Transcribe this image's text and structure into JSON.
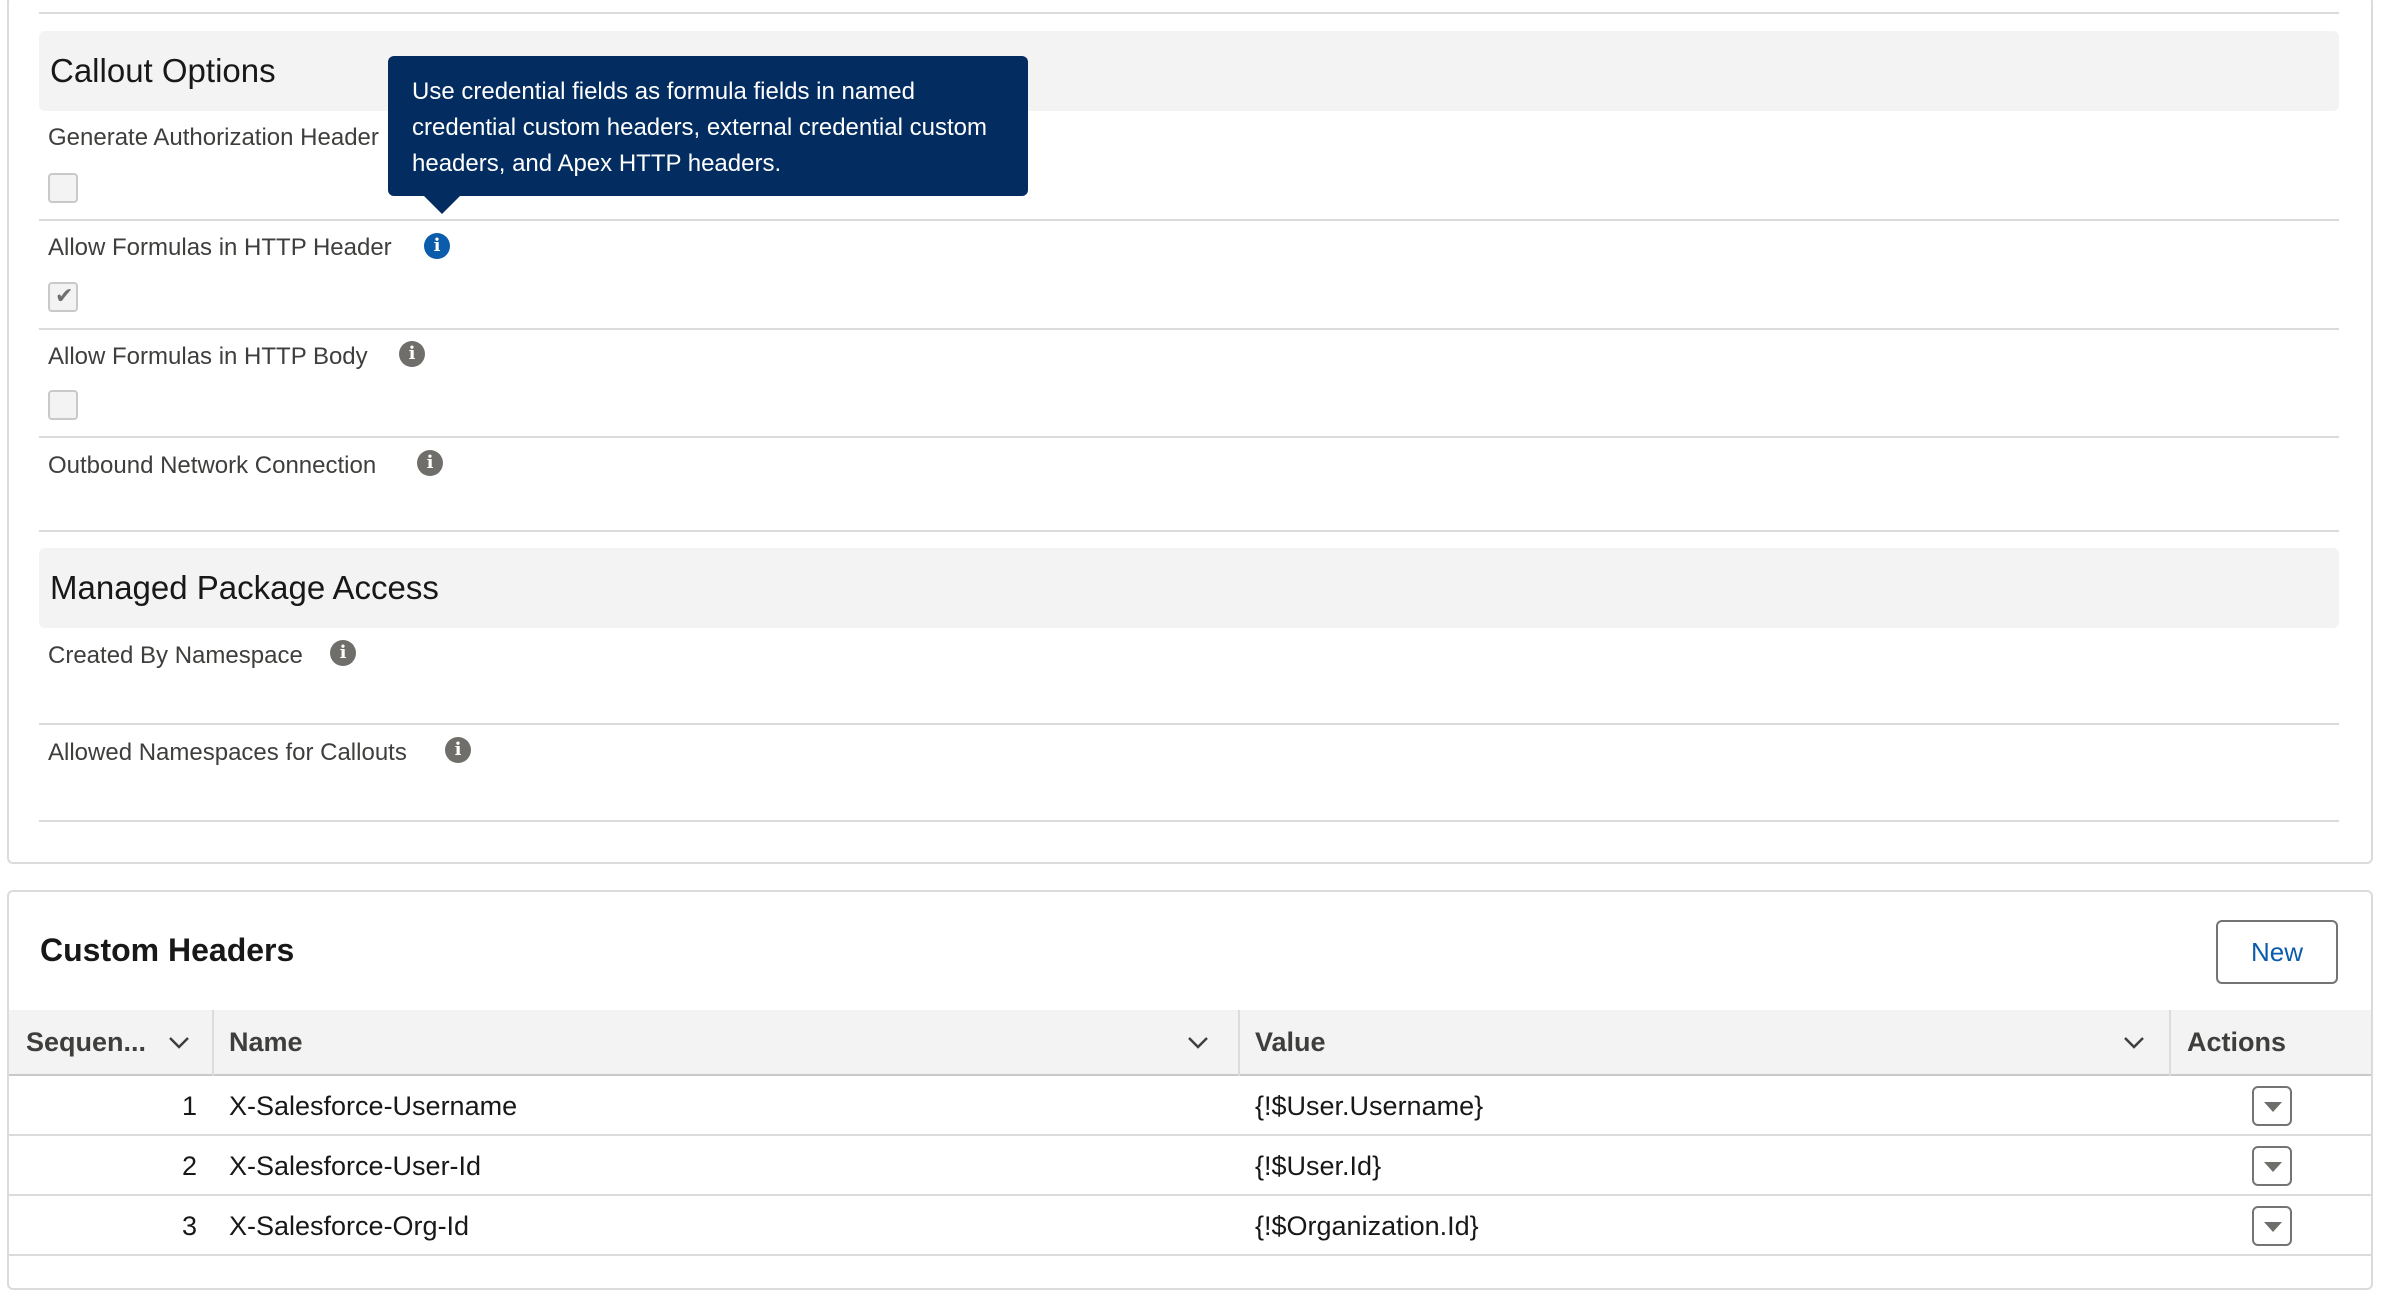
{
  "callout_section": {
    "title": "Callout Options",
    "fields": [
      {
        "label": "Generate Authorization Header",
        "checked": false
      },
      {
        "label": "Allow Formulas in HTTP Header",
        "checked": true
      },
      {
        "label": "Allow Formulas in HTTP Body",
        "checked": false
      },
      {
        "label": "Outbound Network Connection"
      }
    ],
    "tooltip": "Use credential fields as formula fields in named credential custom headers, external credential custom headers, and Apex HTTP headers."
  },
  "managed_section": {
    "title": "Managed Package Access",
    "fields": [
      {
        "label": "Created By Namespace"
      },
      {
        "label": "Allowed Namespaces for Callouts"
      }
    ]
  },
  "custom_headers": {
    "title": "Custom Headers",
    "new_label": "New",
    "columns": {
      "sequence": "Sequen...",
      "name": "Name",
      "value": "Value",
      "actions": "Actions"
    },
    "rows": [
      {
        "seq": "1",
        "name": "X-Salesforce-Username",
        "value": "{!$User.Username}"
      },
      {
        "seq": "2",
        "name": "X-Salesforce-User-Id",
        "value": "{!$User.Id}"
      },
      {
        "seq": "3",
        "name": "X-Salesforce-Org-Id",
        "value": "{!$Organization.Id}"
      }
    ]
  },
  "icons": {
    "info": "info-icon",
    "chevron": "chevron-down-icon",
    "row_menu": "row-menu-icon",
    "check": "checkmark-icon"
  },
  "colors": {
    "tooltip_bg": "#032d60",
    "link": "#0b5cab",
    "section_bg": "#f3f3f3"
  }
}
